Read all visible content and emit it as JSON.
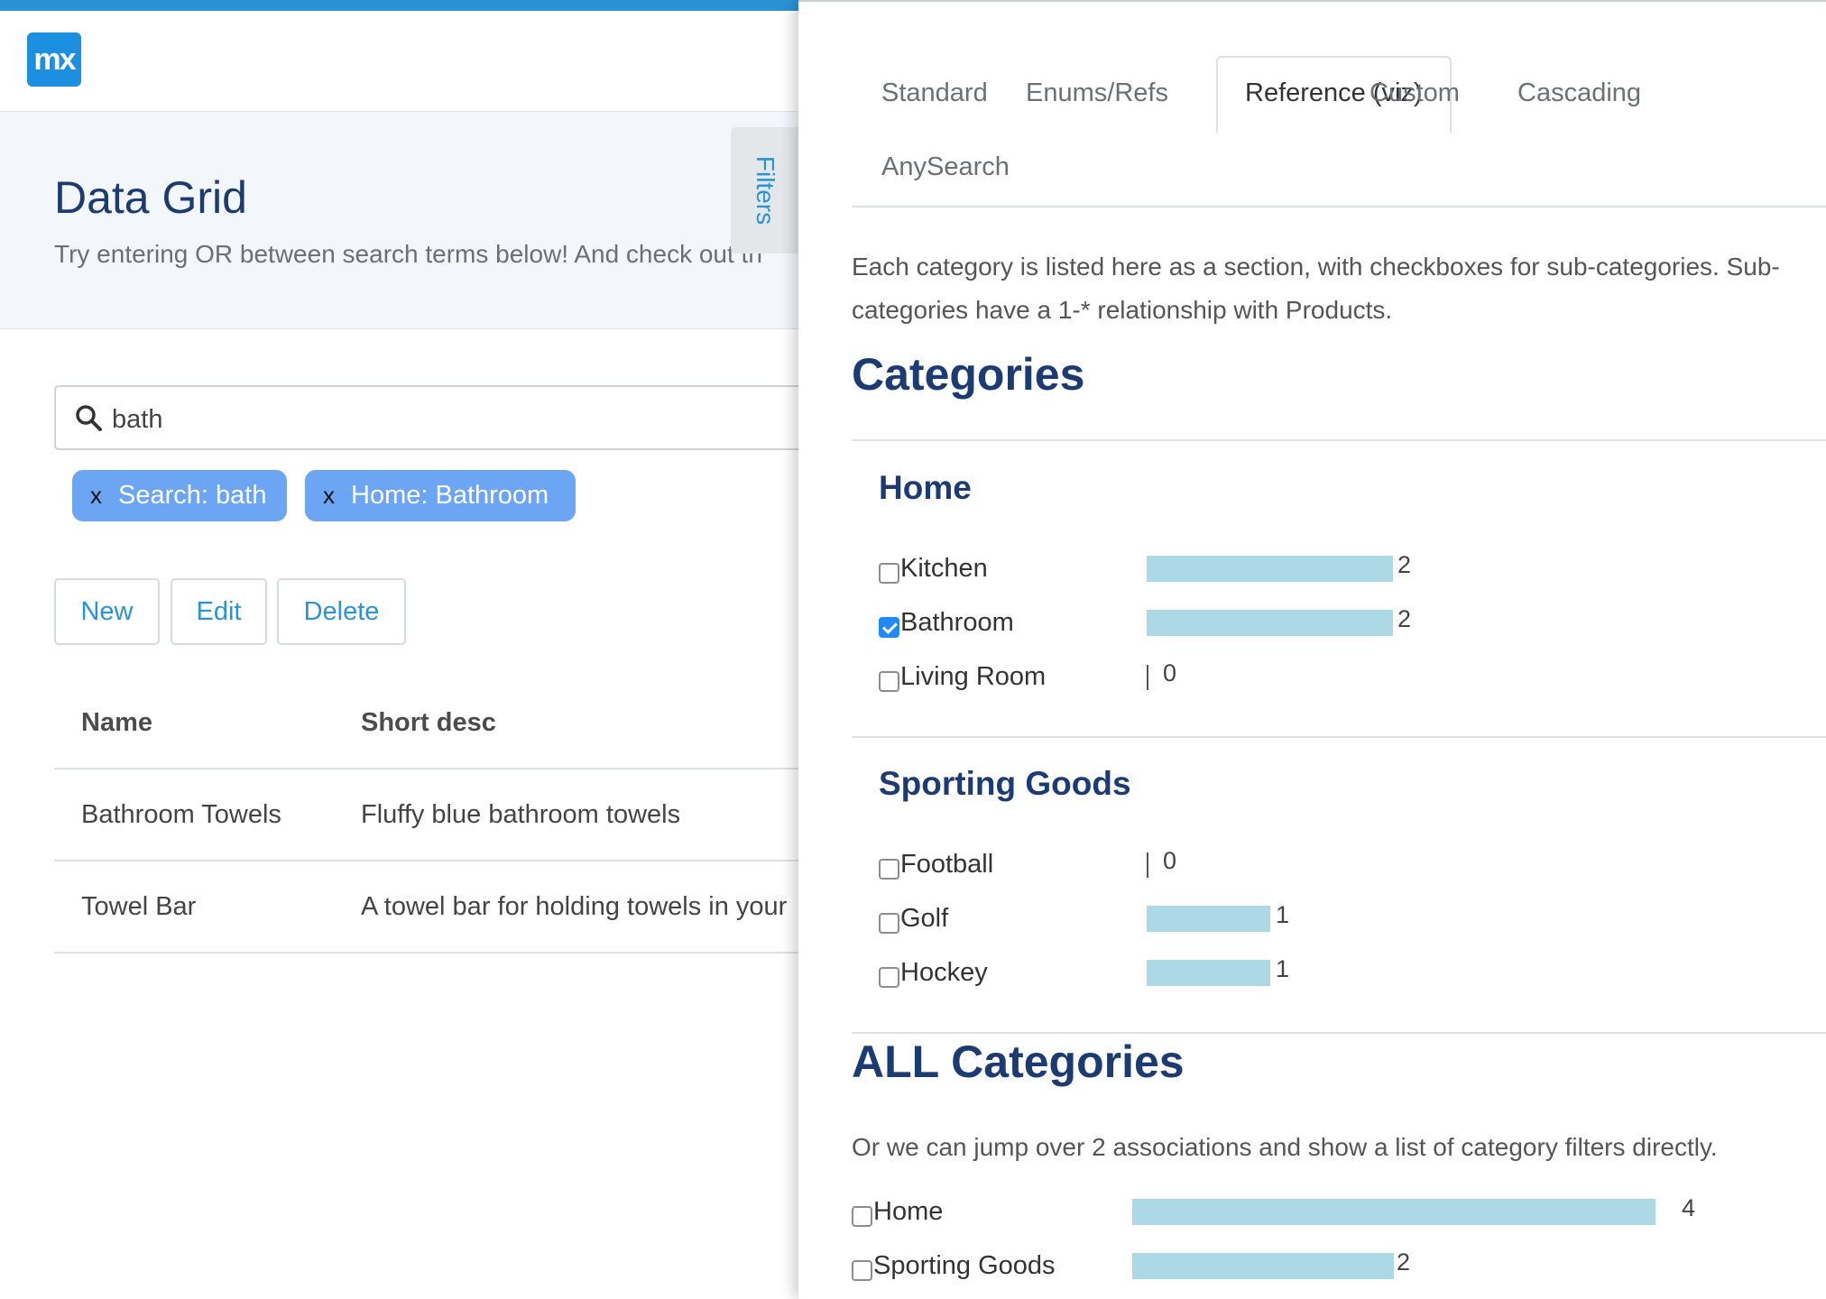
{
  "app": {
    "logo_text": "mx",
    "page_title": "Data Grid",
    "page_subtitle": "Try entering OR between search terms below! And check out th",
    "filters_tab_label": "Filters"
  },
  "search": {
    "value": "bath"
  },
  "active_filters": [
    {
      "remove_label": "x",
      "label": "Search: bath"
    },
    {
      "remove_label": "x",
      "label": "Home: Bathroom"
    }
  ],
  "toolbar": {
    "new_label": "New",
    "edit_label": "Edit",
    "delete_label": "Delete"
  },
  "grid": {
    "columns": [
      "Name",
      "Short desc"
    ],
    "rows": [
      [
        "Bathroom Towels",
        "Fluffy blue bathroom towels"
      ],
      [
        "Towel Bar",
        "A towel bar for holding towels in your"
      ]
    ]
  },
  "panel": {
    "tabs": [
      "Standard",
      "Enums/Refs",
      "Reference (viz)",
      "Custom",
      "Cascading",
      "AnySearch"
    ],
    "active_tab": "Reference (viz)",
    "description": "Each category is listed here as a section, with checkboxes for sub-categories. Sub-categories have a 1-* relationship with Products.",
    "categories_heading": "Categories",
    "sections": [
      {
        "title": "Home",
        "items": [
          {
            "label": "Kitchen",
            "count": 2,
            "checked": false
          },
          {
            "label": "Bathroom",
            "count": 2,
            "checked": true
          },
          {
            "label": "Living Room",
            "count": 0,
            "checked": false
          }
        ]
      },
      {
        "title": "Sporting Goods",
        "items": [
          {
            "label": "Football",
            "count": 0,
            "checked": false
          },
          {
            "label": "Golf",
            "count": 1,
            "checked": false
          },
          {
            "label": "Hockey",
            "count": 1,
            "checked": false
          }
        ]
      }
    ],
    "all_categories_heading": "ALL Categories",
    "all_categories_description": "Or we can jump over 2 associations and show a list of category filters directly.",
    "all_categories": [
      {
        "label": "Home",
        "count": 4,
        "checked": false
      },
      {
        "label": "Sporting Goods",
        "count": 2,
        "checked": false
      }
    ]
  },
  "colors": {
    "accent": "#2a93d5",
    "heading": "#1c3b73",
    "chip": "#6ca5f4",
    "bar": "#add8e6",
    "checkbox_checked": "#1f8af5"
  }
}
